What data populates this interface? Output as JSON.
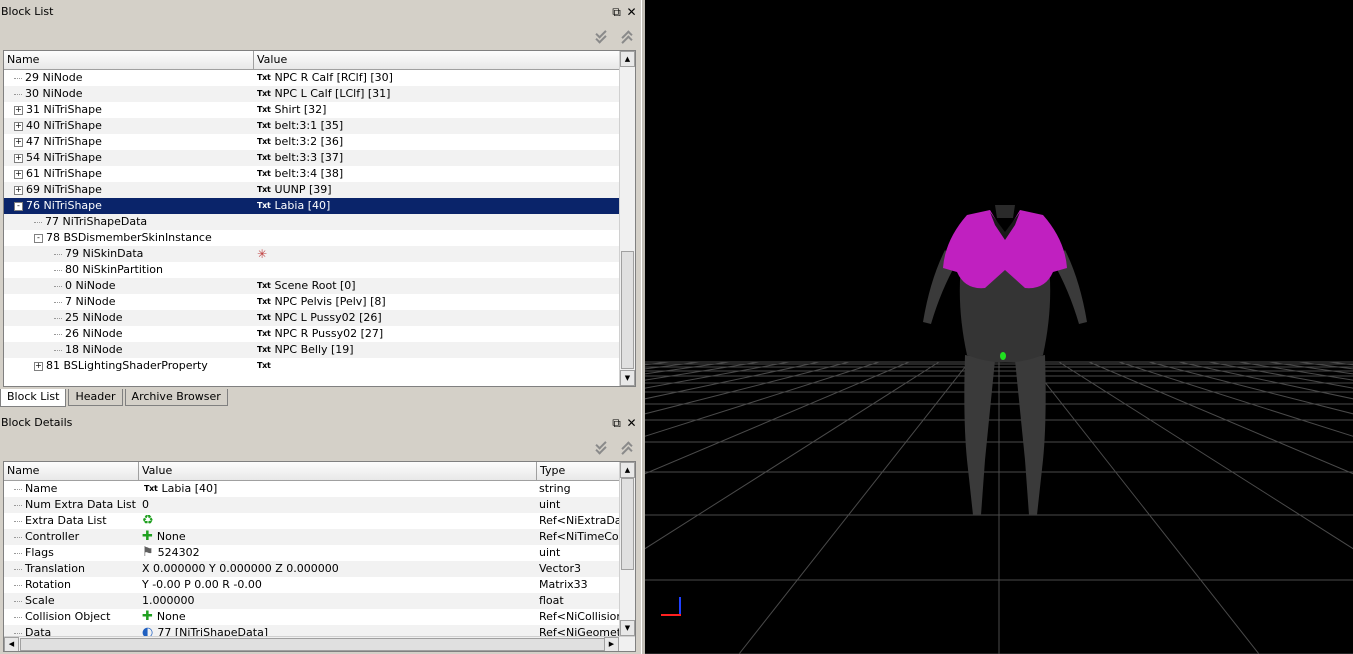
{
  "block_list": {
    "title": "Block List",
    "columns": [
      "Name",
      "Value"
    ],
    "rows": [
      {
        "depth": 2,
        "expand": "",
        "name": "29 NiNode",
        "txt": true,
        "value": "NPC R Calf [RClf] [30]"
      },
      {
        "depth": 2,
        "expand": "",
        "name": "30 NiNode",
        "txt": true,
        "value": "NPC L Calf [LClf] [31]"
      },
      {
        "depth": 2,
        "expand": "+",
        "name": "31 NiTriShape",
        "txt": true,
        "value": "Shirt [32]"
      },
      {
        "depth": 2,
        "expand": "+",
        "name": "40 NiTriShape",
        "txt": true,
        "value": "belt:3:1 [35]"
      },
      {
        "depth": 2,
        "expand": "+",
        "name": "47 NiTriShape",
        "txt": true,
        "value": "belt:3:2 [36]"
      },
      {
        "depth": 2,
        "expand": "+",
        "name": "54 NiTriShape",
        "txt": true,
        "value": "belt:3:3 [37]"
      },
      {
        "depth": 2,
        "expand": "+",
        "name": "61 NiTriShape",
        "txt": true,
        "value": "belt:3:4 [38]"
      },
      {
        "depth": 2,
        "expand": "+",
        "name": "69 NiTriShape",
        "txt": true,
        "value": "UUNP [39]"
      },
      {
        "depth": 2,
        "expand": "-",
        "name": "76 NiTriShape",
        "txt": true,
        "value": "Labia [40]",
        "selected": true
      },
      {
        "depth": 3,
        "expand": "",
        "name": "77 NiTriShapeData",
        "txt": false,
        "value": ""
      },
      {
        "depth": 3,
        "expand": "-",
        "name": "78 BSDismemberSkinInstance",
        "txt": false,
        "value": ""
      },
      {
        "depth": 4,
        "expand": "",
        "name": "79 NiSkinData",
        "txt": false,
        "value": "",
        "icon": "skin-data-icon"
      },
      {
        "depth": 4,
        "expand": "",
        "name": "80 NiSkinPartition",
        "txt": false,
        "value": ""
      },
      {
        "depth": 4,
        "expand": "",
        "name": "0 NiNode",
        "txt": true,
        "value": "Scene Root [0]"
      },
      {
        "depth": 4,
        "expand": "",
        "name": "7 NiNode",
        "txt": true,
        "value": "NPC Pelvis [Pelv] [8]"
      },
      {
        "depth": 4,
        "expand": "",
        "name": "25 NiNode",
        "txt": true,
        "value": "NPC L Pussy02 [26]"
      },
      {
        "depth": 4,
        "expand": "",
        "name": "26 NiNode",
        "txt": true,
        "value": "NPC R Pussy02 [27]"
      },
      {
        "depth": 4,
        "expand": "",
        "name": "18 NiNode",
        "txt": true,
        "value": "NPC Belly [19]"
      },
      {
        "depth": 3,
        "expand": "+",
        "name": "81 BSLightingShaderProperty",
        "txt": true,
        "value": ""
      }
    ]
  },
  "tabs": [
    "Block List",
    "Header",
    "Archive Browser"
  ],
  "block_details": {
    "title": "Block Details",
    "columns": [
      "Name",
      "Value",
      "Type"
    ],
    "rows": [
      {
        "name": "Name",
        "icon": "txt",
        "value": "Labia [40]",
        "type": "string"
      },
      {
        "name": "Num Extra Data List",
        "icon": "",
        "value": "0",
        "type": "uint"
      },
      {
        "name": "Extra Data List",
        "icon": "link-icon",
        "value": "",
        "type": "Ref<NiExtraData>"
      },
      {
        "name": "Controller",
        "icon": "plus-icon",
        "value": "None",
        "type": "Ref<NiTimeController>"
      },
      {
        "name": "Flags",
        "icon": "flag-icon",
        "value": "524302",
        "type": "uint"
      },
      {
        "name": "Translation",
        "icon": "",
        "value": "X 0.000000 Y 0.000000 Z 0.000000",
        "type": "Vector3"
      },
      {
        "name": "Rotation",
        "icon": "",
        "value": "Y -0.00 P 0.00 R -0.00",
        "type": "Matrix33"
      },
      {
        "name": "Scale",
        "icon": "",
        "value": "1.000000",
        "type": "float"
      },
      {
        "name": "Collision Object",
        "icon": "plus-icon",
        "value": "None",
        "type": "Ref<NiCollisionObject>"
      },
      {
        "name": "Data",
        "icon": "data-icon",
        "value": "77 [NiTriShapeData]",
        "type": "Ref<NiGeometryData>"
      }
    ]
  },
  "txt_label": "Txt",
  "colors": {
    "selection": "#0a246a",
    "body": "#3a3a3a",
    "shirt": "#c020c0",
    "accent_green": "#20e020"
  }
}
